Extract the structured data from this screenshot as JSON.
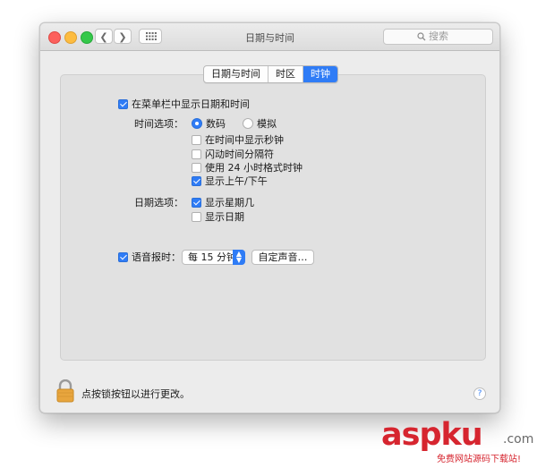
{
  "window": {
    "title": "日期与时间",
    "search_placeholder": "搜索"
  },
  "icons": {
    "back": "chevron-left-icon",
    "forward": "chevron-right-icon",
    "show_all": "grid-icon",
    "search": "search-icon",
    "lock": "lock-icon",
    "help": "help-icon"
  },
  "tabs": [
    {
      "label": "日期与时间",
      "active": false
    },
    {
      "label": "时区",
      "active": false
    },
    {
      "label": "时钟",
      "active": true
    }
  ],
  "clock": {
    "show_in_menubar": {
      "label": "在菜单栏中显示日期和时间",
      "checked": true
    },
    "time_options_label": "时间选项：",
    "radio_digital": {
      "label": "数码",
      "selected": true
    },
    "radio_analog": {
      "label": "模拟",
      "selected": false
    },
    "time_checks": [
      {
        "label": "在时间中显示秒钟",
        "checked": false
      },
      {
        "label": "闪动时间分隔符",
        "checked": false
      },
      {
        "label": "使用 24 小时格式时钟",
        "checked": false
      },
      {
        "label": "显示上午/下午",
        "checked": true
      }
    ],
    "date_options_label": "日期选项：",
    "date_checks": [
      {
        "label": "显示星期几",
        "checked": true
      },
      {
        "label": "显示日期",
        "checked": false
      }
    ],
    "announce": {
      "label": "语音报时：",
      "checked": true
    },
    "interval_value": "每 15 分钟",
    "custom_voice_button": "自定声音…"
  },
  "footer": {
    "lock_text": "点按锁按钮以进行更改。",
    "help_symbol": "?"
  },
  "watermark": {
    "brand": "aspku",
    "tld": ".com",
    "tagline": "免费网站源码下载站!"
  },
  "colors": {
    "accent": "#2f7cf6",
    "watermark_red": "#d6252f"
  }
}
